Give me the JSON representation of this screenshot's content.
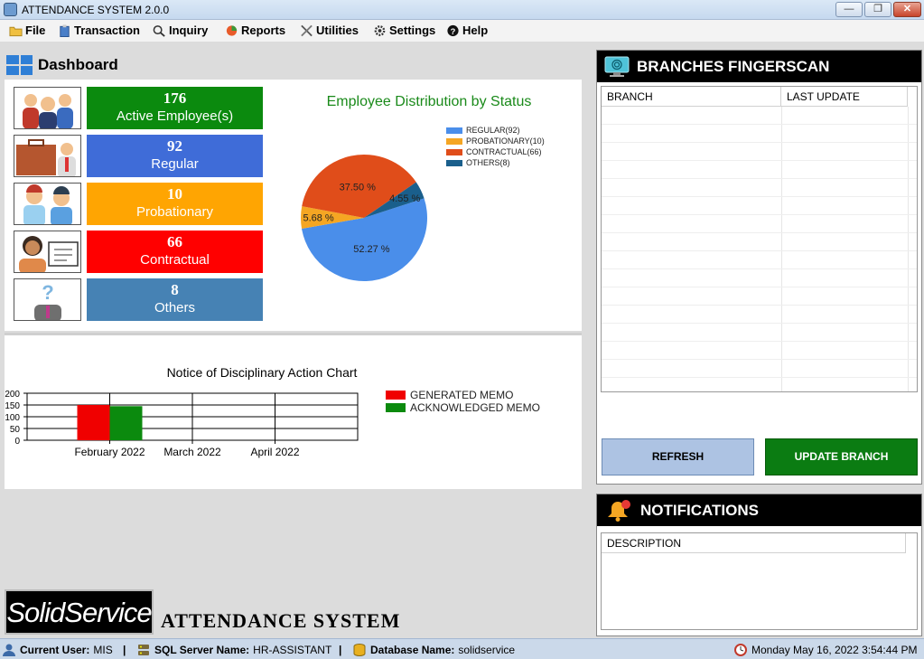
{
  "window": {
    "title": "ATTENDANCE SYSTEM 2.0.0",
    "minimize_glyph": "—",
    "maximize_glyph": "❐",
    "close_glyph": "✕"
  },
  "menu": [
    {
      "label": "File",
      "icon": "folder-icon"
    },
    {
      "label": "Transaction",
      "icon": "clipboard-icon"
    },
    {
      "label": "Inquiry",
      "icon": "search-icon"
    },
    {
      "label": "Reports",
      "icon": "chart-icon"
    },
    {
      "label": "Utilities",
      "icon": "tools-icon"
    },
    {
      "label": "Settings",
      "icon": "gear-icon"
    },
    {
      "label": "Help",
      "icon": "help-icon"
    }
  ],
  "dashboard": {
    "title": "Dashboard",
    "stats": [
      {
        "value": "176",
        "label": "Active Employee(s)",
        "color": "#0b8a0e",
        "icon": "employees-group-icon"
      },
      {
        "value": "92",
        "label": "Regular",
        "color": "#3f6cd8",
        "icon": "briefcase-employee-icon"
      },
      {
        "value": "10",
        "label": "Probationary",
        "color": "#ffa502",
        "icon": "trainees-icon"
      },
      {
        "value": "66",
        "label": "Contractual",
        "color": "#ff0000",
        "icon": "contract-worker-icon"
      },
      {
        "value": "8",
        "label": "Others",
        "color": "#4682b4",
        "icon": "unknown-person-icon"
      }
    ]
  },
  "chart_data": [
    {
      "type": "pie",
      "title": "Employee Distribution by Status",
      "categories": [
        "REGULAR(92)",
        "PROBATIONARY(10)",
        "CONTRACTUAL(66)",
        "OTHERS(8)"
      ],
      "values": [
        52.27,
        5.68,
        37.5,
        4.55
      ],
      "value_labels": [
        "52.27 %",
        "5.68 %",
        "37.50 %",
        "4.55 %"
      ],
      "colors": [
        "#4a8eea",
        "#f5a623",
        "#e04d1a",
        "#1a5f8c"
      ],
      "legend": "top-right"
    },
    {
      "type": "bar",
      "title": "Notice of Disciplinary Action Chart",
      "categories": [
        "February 2022",
        "March 2022",
        "April 2022"
      ],
      "series": [
        {
          "name": "GENERATED MEMO",
          "values": [
            150,
            0,
            0
          ],
          "color": "#f00000"
        },
        {
          "name": "ACKNOWLEDGED MEMO",
          "values": [
            145,
            0,
            0
          ],
          "color": "#0b8a0e"
        }
      ],
      "yticks": [
        "200",
        "150",
        "100",
        "50",
        "0"
      ],
      "ylim": [
        0,
        200
      ],
      "grid": true,
      "legend": "right"
    }
  ],
  "brand": {
    "logo_text": "SolidService",
    "name": "ATTENDANCE SYSTEM"
  },
  "branches": {
    "title": "BRANCHES FINGERSCAN",
    "columns": [
      "BRANCH",
      "LAST UPDATE"
    ],
    "refresh_label": "REFRESH",
    "update_label": "UPDATE BRANCH"
  },
  "notifications": {
    "title": "NOTIFICATIONS",
    "columns": [
      "DESCRIPTION"
    ]
  },
  "status": {
    "user_label": "Current User:",
    "user_value": "MIS",
    "server_label": "SQL Server Name:",
    "server_value": "HR-ASSISTANT",
    "db_label": "Database Name:",
    "db_value": "solidservice",
    "separator": "|",
    "datetime": "Monday May 16, 2022 3:54:44 PM"
  }
}
